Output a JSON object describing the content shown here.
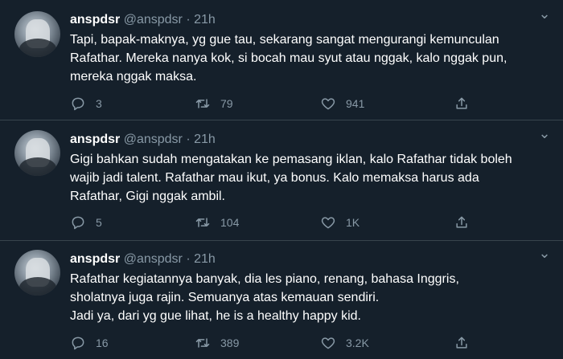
{
  "tweets": [
    {
      "name": "anspdsr",
      "handle": "@anspdsr",
      "dot": "·",
      "time": "21h",
      "lines": [
        "Tapi, bapak-maknya, yg gue tau, sekarang sangat mengurangi kemunculan",
        "Rafathar. Mereka nanya kok, si bocah mau syut atau nggak, kalo nggak pun,",
        "mereka nggak maksa."
      ],
      "replies": "3",
      "retweets": "79",
      "likes": "941"
    },
    {
      "name": "anspdsr",
      "handle": "@anspdsr",
      "dot": "·",
      "time": "21h",
      "lines": [
        "Gigi bahkan sudah mengatakan ke pemasang iklan, kalo Rafathar tidak boleh",
        "wajib jadi talent. Rafathar mau ikut, ya bonus. Kalo memaksa harus ada",
        "Rafathar, Gigi nggak ambil."
      ],
      "replies": "5",
      "retweets": "104",
      "likes": "1K"
    },
    {
      "name": "anspdsr",
      "handle": "@anspdsr",
      "dot": "·",
      "time": "21h",
      "lines": [
        "Rafathar kegiatannya banyak, dia les piano, renang, bahasa Inggris,",
        "sholatnya juga rajin. Semuanya atas kemauan sendiri.",
        "Jadi ya, dari yg gue lihat, he is a healthy happy kid."
      ],
      "replies": "16",
      "retweets": "389",
      "likes": "3.2K"
    }
  ],
  "icons": {
    "reply": "reply-icon",
    "retweet": "retweet-icon",
    "like": "heart-icon",
    "share": "share-icon",
    "more": "chevron-down-icon"
  },
  "colors": {
    "background": "#15202b",
    "secondary_text": "#8899a6",
    "divider": "#38444d"
  }
}
